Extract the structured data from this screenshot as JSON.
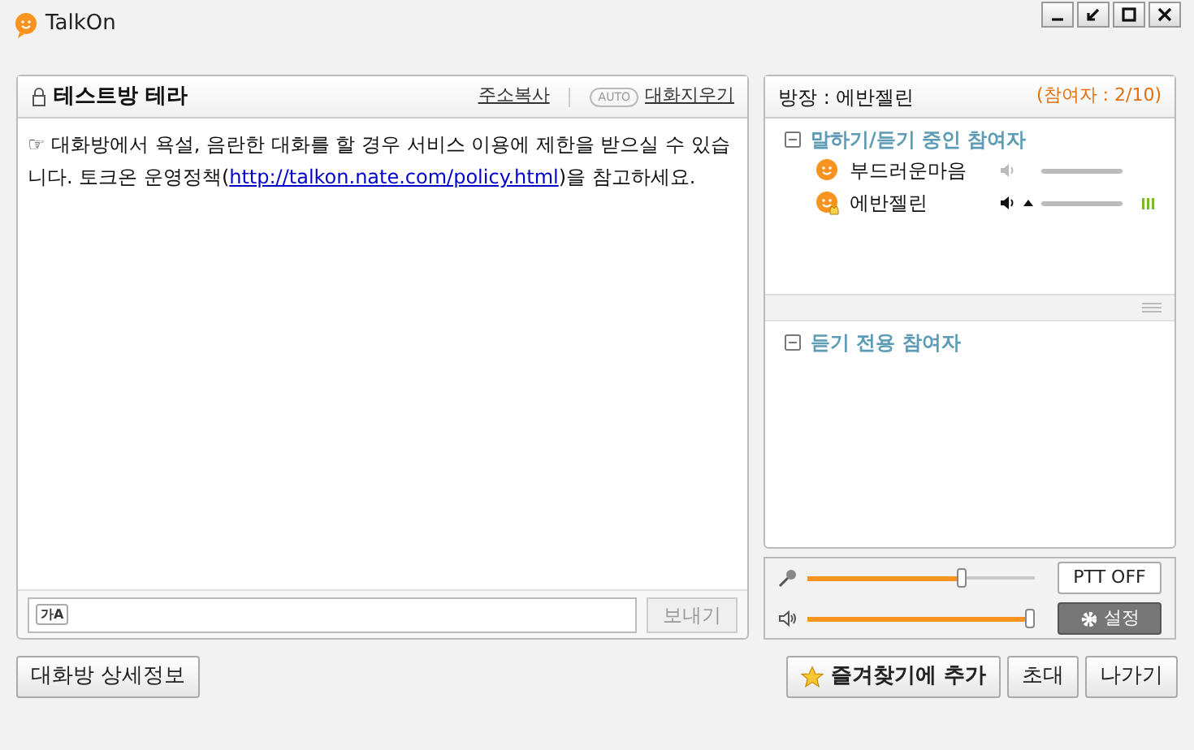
{
  "window": {
    "title": "TalkOn"
  },
  "chat": {
    "room_title": "테스트방 테라",
    "copy_address": "주소복사",
    "auto_badge": "AUTO",
    "clear_chat": "대화지우기",
    "notice_icon": "☞",
    "notice_before": "대화방에서 욕설, 음란한 대화를 할 경우 서비스 이용에 제한을 받으실 수 있습니다.  토크온 운영정책(",
    "notice_link": "http://talkon.nate.com/policy.html",
    "notice_after": ")을 참고하세요.",
    "input_badge": "가A",
    "send_button": "보내기"
  },
  "room": {
    "host": "방장 : 에반젤린",
    "count": "(참여자 : 2/10)",
    "groups": [
      {
        "title": "말하기/듣기 중인 참여자",
        "expanded": true,
        "members": [
          {
            "name": "부드러운마음",
            "host": false,
            "speaking": false,
            "level": 1
          },
          {
            "name": "에반젤린",
            "host": true,
            "speaking": true,
            "level": 1
          }
        ]
      },
      {
        "title": "듣기 전용 참여자",
        "expanded": true
      }
    ]
  },
  "audio": {
    "mic": {
      "level": 0.7
    },
    "speaker": {
      "level": 1
    },
    "ptt_button": "PTT OFF",
    "settings_button": "설정"
  },
  "footer": {
    "details_button": "대화방 상세정보",
    "favorite_button": "즐겨찾기에 추가",
    "invite_button": "초대",
    "leave_button": "나가기"
  }
}
